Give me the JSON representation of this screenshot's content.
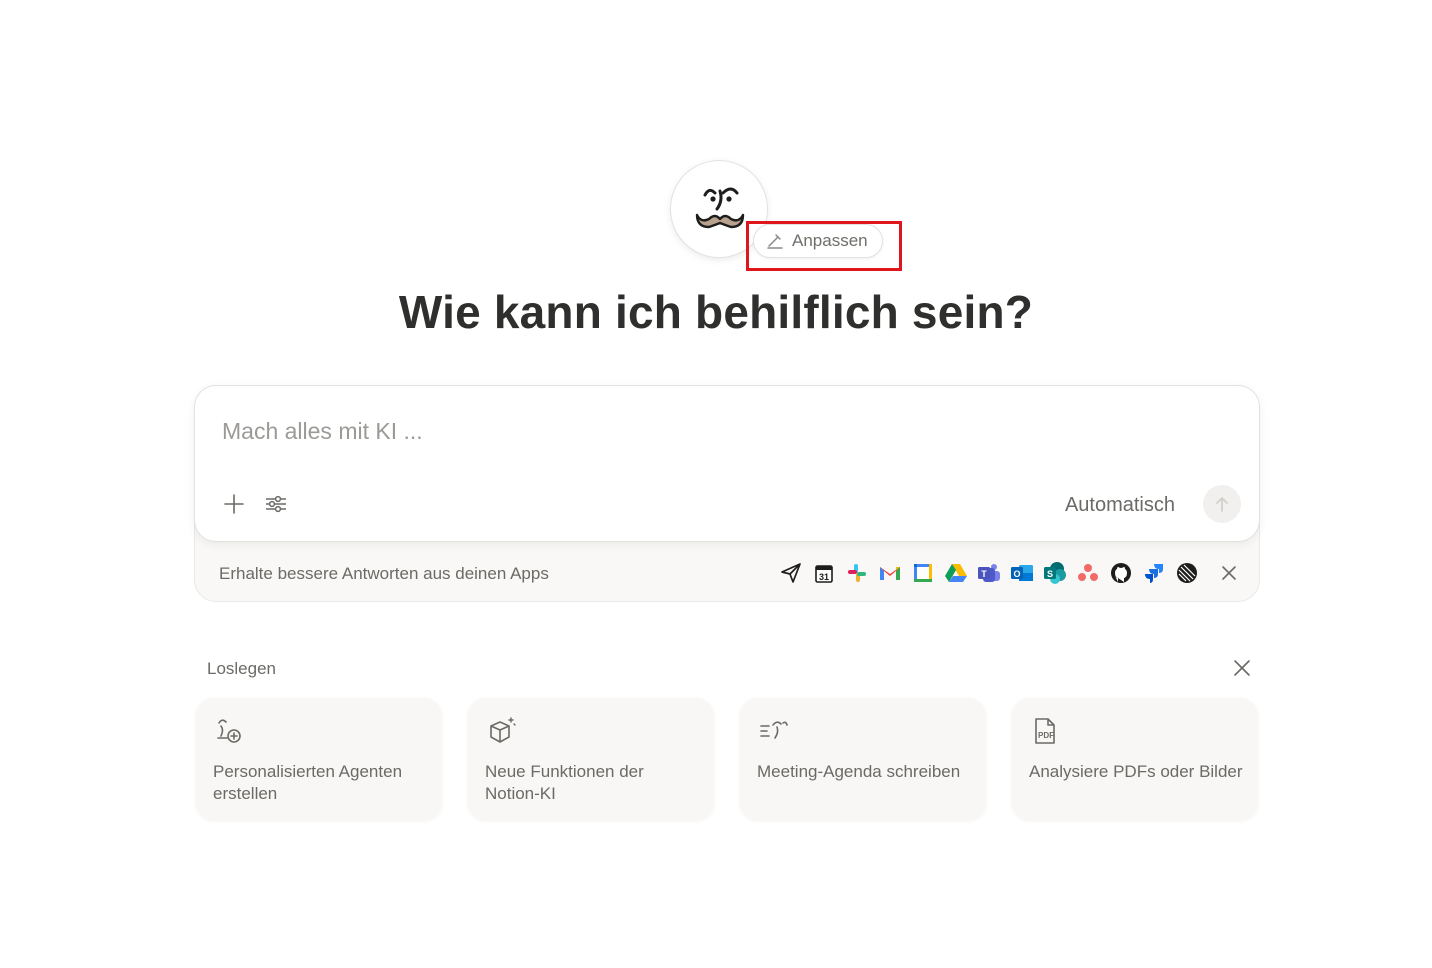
{
  "assistant": {
    "avatar_icon": "notion-ai-face-icon",
    "customize_label": "Anpassen"
  },
  "heading": "Wie kann ich behilflich sein?",
  "composer": {
    "placeholder": "Mach alles mit KI ...",
    "mode_label": "Automatisch",
    "add_icon": "plus-icon",
    "settings_icon": "sliders-icon",
    "send_icon": "arrow-up-icon"
  },
  "apps_banner": {
    "text": "Erhalte bessere Antworten aus deinen Apps",
    "apps": [
      "send-icon",
      "calendar-icon",
      "slack-icon",
      "gmail-icon",
      "google-calendar-icon",
      "google-drive-icon",
      "teams-icon",
      "outlook-icon",
      "sharepoint-icon",
      "asana-icon",
      "github-icon",
      "jira-icon",
      "linear-icon"
    ]
  },
  "get_started": {
    "label": "Loslegen",
    "cards": [
      {
        "label": "Personalisierten Agenten erstellen",
        "icon": "agent-add-icon"
      },
      {
        "label": "Neue Funktionen der Notion-KI",
        "icon": "sparkle-box-icon"
      },
      {
        "label": "Meeting-Agenda schreiben",
        "icon": "agenda-icon"
      },
      {
        "label": "Analysiere PDFs oder Bilder",
        "icon": "pdf-icon"
      }
    ]
  },
  "colors": {
    "highlight": "#e0161d",
    "text": "#37352f",
    "muted": "#6b6a66"
  }
}
